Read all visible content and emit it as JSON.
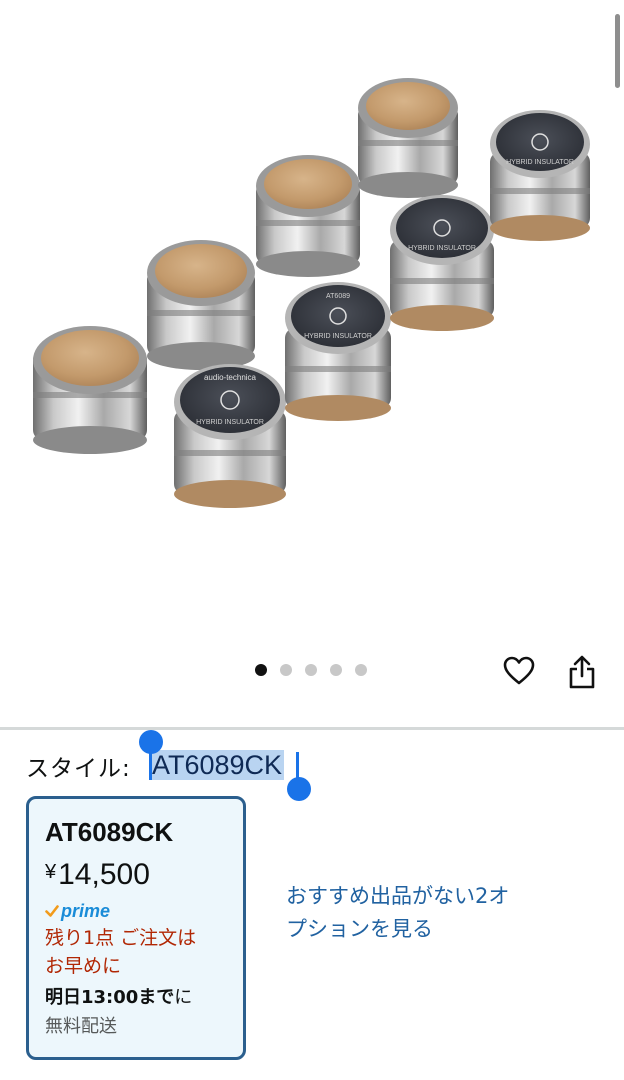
{
  "gallery": {
    "image_alt": "Audio-Technica AT6089CK Hybrid Insulator set (cork and metal feet)",
    "insulator_brand_text": "audio-technica",
    "insulator_product_text": "HYBRID INSULATOR",
    "insulator_model_text": "AT6089",
    "dots_total": 5,
    "active_dot": 1
  },
  "actions": {
    "wishlist_icon": "heart-icon",
    "share_icon": "share-icon"
  },
  "style": {
    "label": "スタイル:",
    "selected": "AT6089CK"
  },
  "option_card": {
    "title": "AT6089CK",
    "currency": "¥",
    "price": "14,500",
    "prime_label": "prime",
    "stock_line1": "残り1点 ご注文は",
    "stock_line2": "お早めに",
    "delivery_bold": "明日13:00まで",
    "delivery_suffix": "に",
    "shipping": "無料配送"
  },
  "other_options_link": "おすすめ出品がない2オプションを見る",
  "colors": {
    "link": "#2162a1",
    "stock_red": "#b12704",
    "selection_blue": "#1a73e8",
    "card_border": "#2b5f8e"
  }
}
